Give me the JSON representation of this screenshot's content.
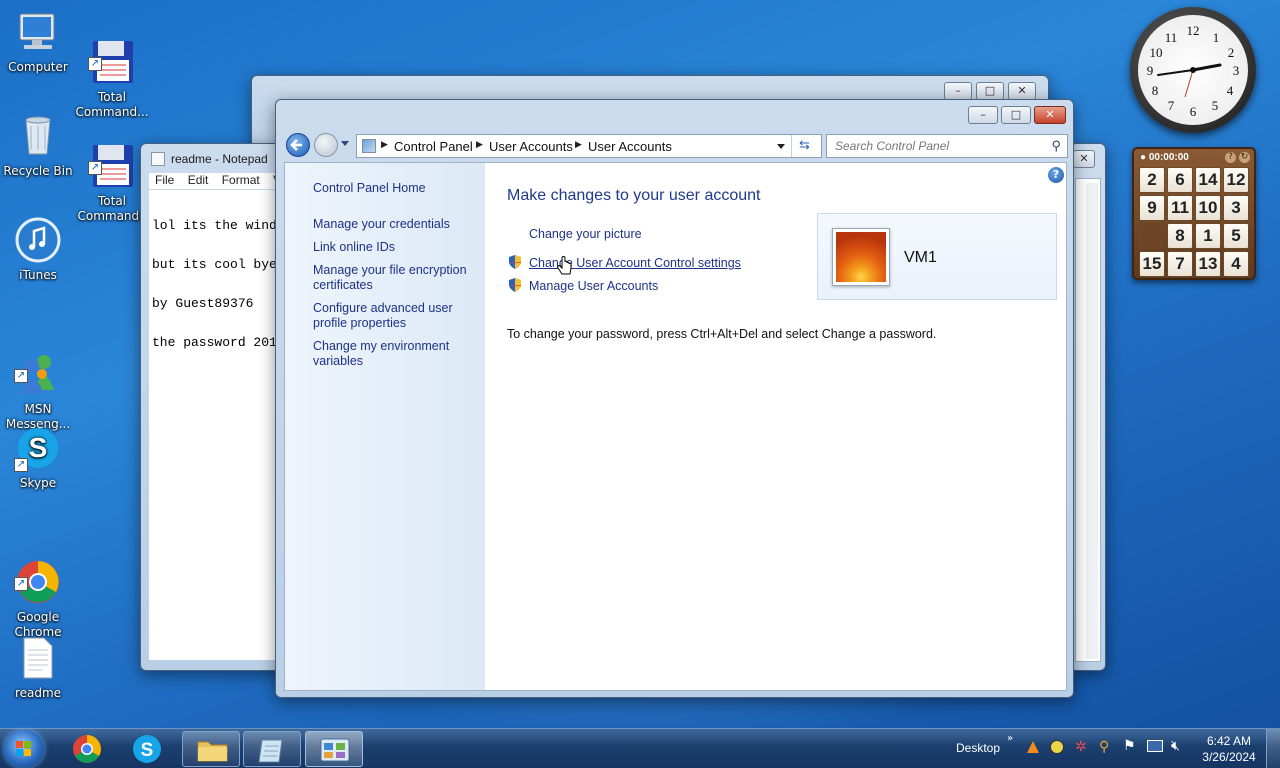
{
  "desktop": {
    "icons": [
      {
        "label": "Computer",
        "icon": "computer-icon"
      },
      {
        "label": "Recycle Bin",
        "icon": "recycle-bin-icon"
      },
      {
        "label": "iTunes",
        "icon": "itunes-icon"
      },
      {
        "label": "MSN\nMesseng...",
        "icon": "msn-messenger-icon"
      },
      {
        "label": "Skype",
        "icon": "skype-icon"
      },
      {
        "label": "Google\nChrome",
        "icon": "chrome-icon"
      },
      {
        "label": "readme",
        "icon": "text-file-icon"
      },
      {
        "label": "Total\nCommand...",
        "icon": "floppy-disk-icon"
      },
      {
        "label": "Total\nCommande",
        "icon": "floppy-disk-icon"
      }
    ]
  },
  "notepad": {
    "title": "readme - Notepad",
    "menu": [
      "File",
      "Edit",
      "Format",
      "V"
    ],
    "lines": [
      "lol its the wind",
      "but its cool bye",
      "by Guest89376",
      "the password 201"
    ]
  },
  "control_panel": {
    "breadcrumb": [
      "Control Panel",
      "User Accounts",
      "User Accounts"
    ],
    "search_placeholder": "Search Control Panel",
    "left_links": [
      "Control Panel Home",
      "Manage your credentials",
      "Link online IDs",
      "Manage your file encryption certificates",
      "Configure advanced user profile properties",
      "Change my environment variables"
    ],
    "heading": "Make changes to your user account",
    "tasks": [
      "Change your picture",
      "Change User Account Control settings",
      "Manage User Accounts"
    ],
    "account_name": "VM1",
    "password_hint": "To change your password, press Ctrl+Alt+Del and select Change a password."
  },
  "puzzle": {
    "timer": "00:00:00",
    "tiles": [
      "2",
      "6",
      "14",
      "12",
      "9",
      "11",
      "10",
      "3",
      "",
      "8",
      "1",
      "5",
      "15",
      "7",
      "13",
      "4"
    ]
  },
  "clock": {
    "numerals": [
      "12",
      "1",
      "2",
      "3",
      "4",
      "5",
      "6",
      "7",
      "8",
      "9",
      "10",
      "11"
    ]
  },
  "taskbar": {
    "desktop_label": "Desktop",
    "time": "6:42 AM",
    "date": "3/26/2024"
  },
  "colors": {
    "link": "#1e3287",
    "heading": "#1e3a8a",
    "taskbar": "#1b3f6e"
  }
}
